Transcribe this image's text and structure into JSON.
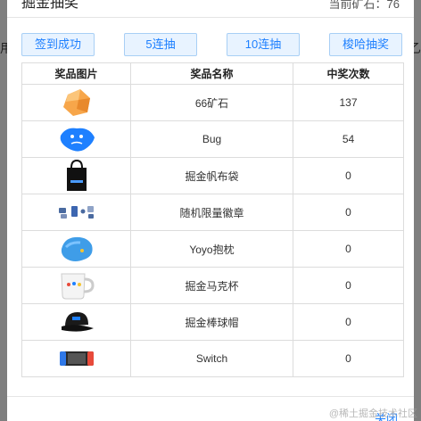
{
  "background": {
    "left_text": "用",
    "right_text": "乙"
  },
  "dialog": {
    "title": "掘金抽奖",
    "points_label": "当前矿石：76",
    "close_label": "关闭"
  },
  "actions": [
    {
      "label": "签到成功"
    },
    {
      "label": "5连抽"
    },
    {
      "label": "10连抽"
    },
    {
      "label": "梭哈抽奖"
    }
  ],
  "table": {
    "headers": [
      "奖品图片",
      "奖品名称",
      "中奖次数"
    ],
    "rows": [
      {
        "name": "66矿石",
        "count": "137",
        "icon": "ore-icon"
      },
      {
        "name": "Bug",
        "count": "54",
        "icon": "bug-icon"
      },
      {
        "name": "掘金帆布袋",
        "count": "0",
        "icon": "tote-bag-icon"
      },
      {
        "name": "随机限量徽章",
        "count": "0",
        "icon": "badge-icon"
      },
      {
        "name": "Yoyo抱枕",
        "count": "0",
        "icon": "pillow-icon"
      },
      {
        "name": "掘金马克杯",
        "count": "0",
        "icon": "mug-icon"
      },
      {
        "name": "掘金棒球帽",
        "count": "0",
        "icon": "cap-icon"
      },
      {
        "name": "Switch",
        "count": "0",
        "icon": "switch-icon"
      }
    ]
  },
  "watermark": "@稀土掘金技术社区",
  "colors": {
    "accent": "#1e80ff",
    "button_bg": "#e8f3ff",
    "overlay": "#7f7f7f"
  }
}
